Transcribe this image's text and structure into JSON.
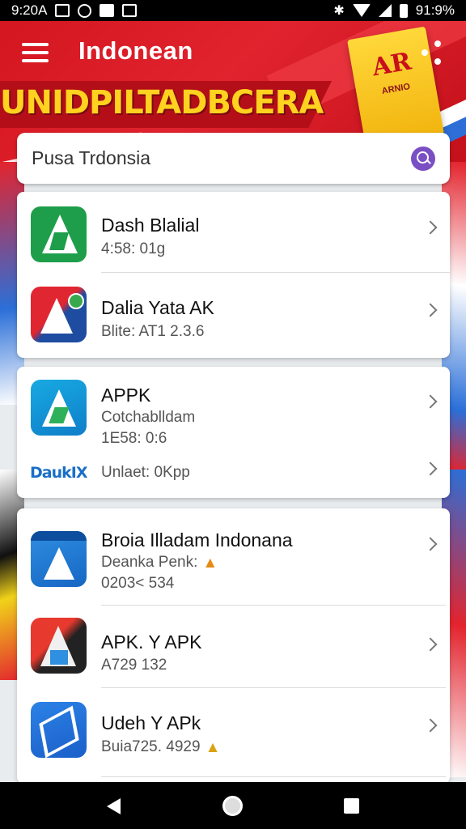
{
  "status_bar": {
    "time": "9:20",
    "left_text": "9:20A",
    "battery_text": "91:9%"
  },
  "header": {
    "title": "Indonean",
    "banner": "UNIDPILTADBCERA",
    "promo_big": "AR",
    "promo_small": "ARNIO"
  },
  "search": {
    "value": "Pusa Trdonsia"
  },
  "cards": [
    {
      "rows": [
        {
          "title": "Dash Blalial",
          "sub": "4:58: 01g",
          "icon": "app-icon-green"
        },
        {
          "title": "Dalia Yata AK",
          "sub": "Blite: AT1 2.3.6",
          "icon": "app-icon-red-blue"
        }
      ]
    },
    {
      "rows": [
        {
          "title": "APPK",
          "sub1": "Cotchablldam",
          "sub2": "1E58: 0:6",
          "icon": "app-icon-cyan"
        },
        {
          "brand": "DaukIX",
          "title": "Unlaet: 0Kpp"
        }
      ]
    },
    {
      "rows": [
        {
          "title": "Broia Illadam Indonana",
          "sub1": "Deanka Penk:",
          "sub2": "0203< 534",
          "icon": "app-icon-blue"
        },
        {
          "title": "APK. Y APK",
          "sub": "A729 132",
          "icon": "app-icon-dark"
        },
        {
          "title": "Udeh Y APk",
          "sub": "Buia725. 4929",
          "icon": "app-icon-outline"
        }
      ]
    }
  ],
  "colors": {
    "header_red": "#d31620",
    "banner_yellow": "#ffd21f",
    "search_accent": "#7a4fc4"
  }
}
